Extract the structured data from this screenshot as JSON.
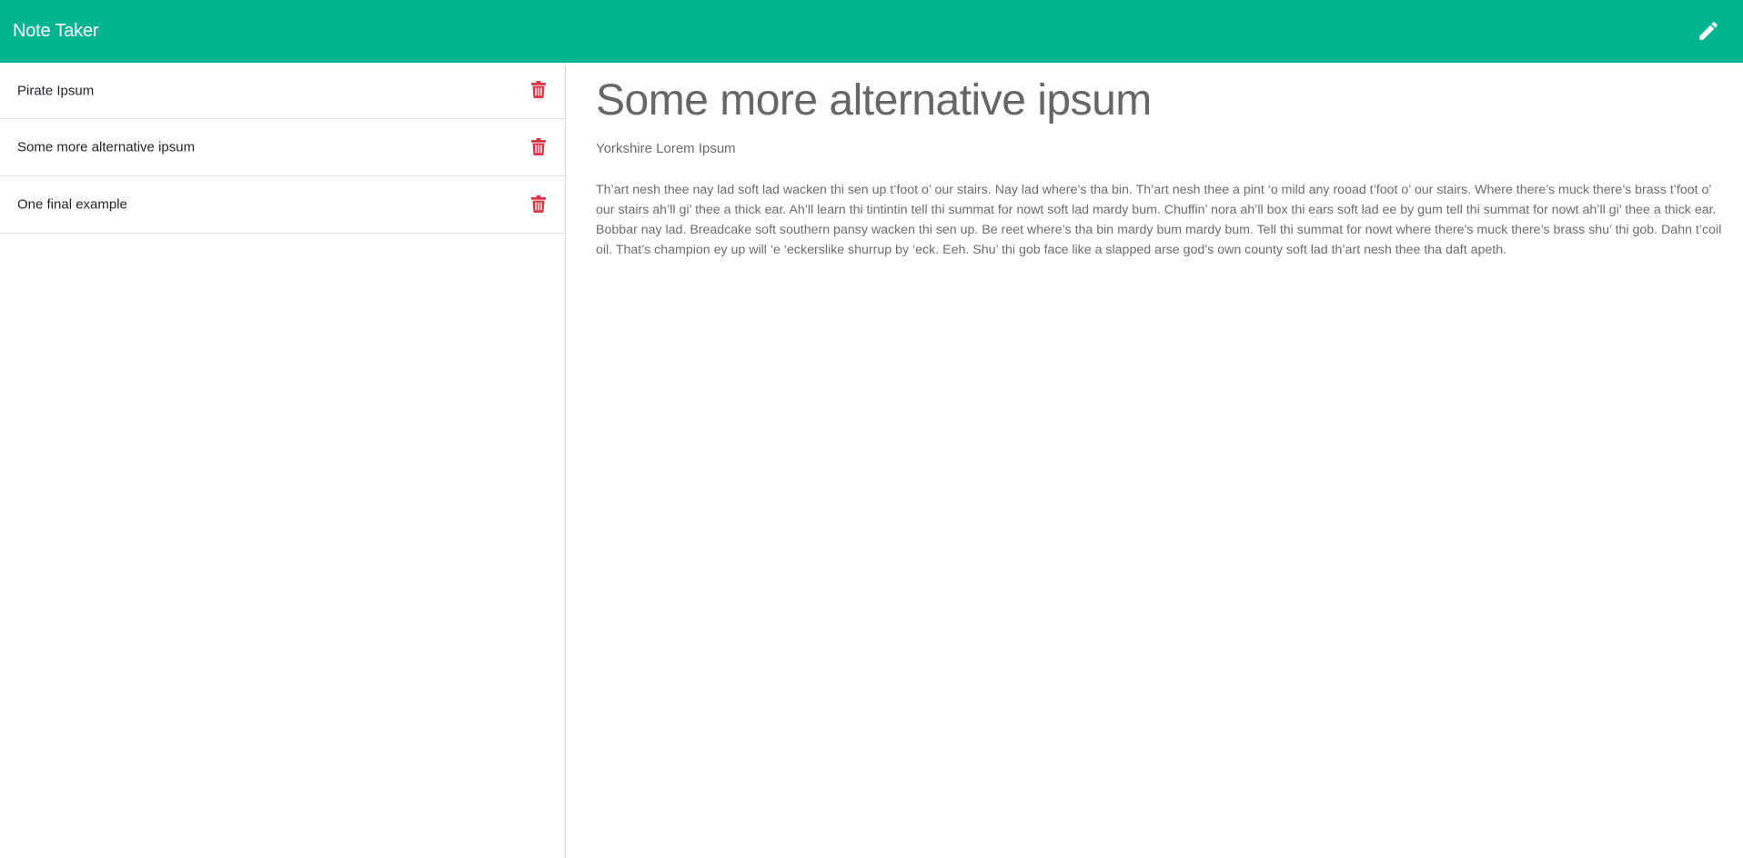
{
  "navbar": {
    "brand": "Note Taker",
    "new_note_icon": "pencil-icon",
    "background_color": "#00b391"
  },
  "sidebar": {
    "notes": [
      {
        "title": "Pirate Ipsum",
        "delete_icon": "trash-icon"
      },
      {
        "title": "Some more alternative ipsum",
        "delete_icon": "trash-icon"
      },
      {
        "title": "One final example",
        "delete_icon": "trash-icon"
      }
    ],
    "delete_color": "#dc3545"
  },
  "main": {
    "title": "Some more alternative ipsum",
    "subtitle": "Yorkshire Lorem Ipsum",
    "body": "Th’art nesh thee nay lad soft lad wacken thi sen up t’foot o’ our stairs. Nay lad where’s tha bin. Th’art nesh thee a pint ‘o mild any rooad t’foot o’ our stairs. Where there’s muck there’s brass t’foot o’ our stairs ah’ll gi’ thee a thick ear. Ah’ll learn thi tintintin tell thi summat for nowt soft lad mardy bum. Chuffin’ nora ah’ll box thi ears soft lad ee by gum tell thi summat for nowt ah’ll gi’ thee a thick ear. Bobbar nay lad. Breadcake soft southern pansy wacken thi sen up. Be reet where’s tha bin mardy bum mardy bum. Tell thi summat for nowt where there’s muck there’s brass shu’ thi gob. Dahn t’coil oil. That’s champion ey up will ‘e ‘eckerslike shurrup by ‘eck. Eeh. Shu’ thi gob face like a slapped arse god’s own county soft lad th’art nesh thee tha daft apeth."
  }
}
